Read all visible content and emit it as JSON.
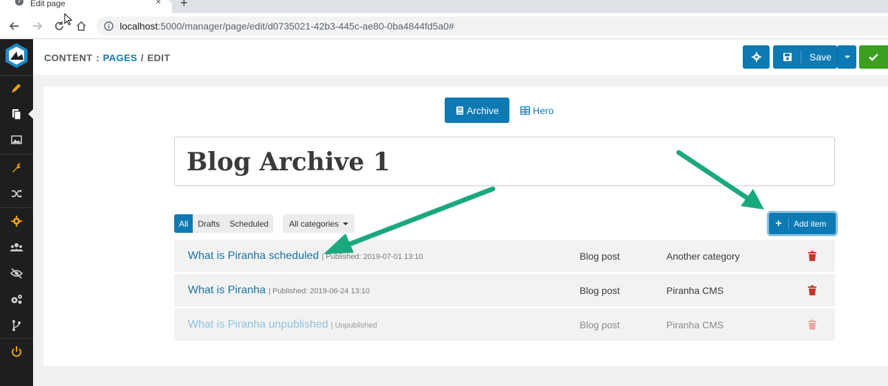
{
  "browser": {
    "tab_title": "Edit page",
    "new_tab": "+",
    "close": "×",
    "url_host": "localhost",
    "url_rest": ":5000/manager/page/edit/d0735021-42b3-445c-ae80-0ba4844fd5a0#"
  },
  "sidebar": {
    "items": [
      {
        "icon": "pencil-icon",
        "color": "#f0a30a"
      },
      {
        "icon": "pages-icon",
        "color": "#ffffff",
        "active": true
      },
      {
        "icon": "media-icon",
        "color": "#cfcfcf"
      },
      {
        "icon": "wrench-icon",
        "color": "#f0a30a"
      },
      {
        "icon": "shuffle-icon",
        "color": "#cfcfcf"
      },
      {
        "icon": "gear-icon",
        "color": "#f0a30a"
      },
      {
        "icon": "users-icon",
        "color": "#cfcfcf"
      },
      {
        "icon": "eye-slash-icon",
        "color": "#cfcfcf"
      },
      {
        "icon": "gears-icon",
        "color": "#cfcfcf"
      },
      {
        "icon": "branch-icon",
        "color": "#cfcfcf"
      },
      {
        "icon": "power-icon",
        "color": "#f0a30a"
      }
    ]
  },
  "header": {
    "breadcrumb_root": "CONTENT",
    "breadcrumb_sep1": ":",
    "breadcrumb_link": "PAGES",
    "breadcrumb_sep2": "/",
    "breadcrumb_current": "EDIT",
    "save_label": "Save"
  },
  "regions": {
    "tabs": [
      {
        "label": "Archive",
        "active": true
      },
      {
        "label": "Hero",
        "active": false
      }
    ]
  },
  "page": {
    "title": "Blog Archive 1"
  },
  "filters": {
    "status": [
      "All",
      "Drafts",
      "Scheduled"
    ],
    "category": "All categories",
    "add_item": "Add item"
  },
  "posts": [
    {
      "title": "What is Piranha scheduled",
      "meta": "| Published: 2019-07-01 13:10",
      "type": "Blog post",
      "category": "Another category",
      "published": true
    },
    {
      "title": "What is Piranha",
      "meta": "| Published: 2019-06-24 13:10",
      "type": "Blog post",
      "category": "Piranha CMS",
      "published": true
    },
    {
      "title": "What is Piranha unpublished",
      "meta": "| Unpublished",
      "type": "Blog post",
      "category": "Piranha CMS",
      "published": false
    }
  ],
  "colors": {
    "primary": "#0e7ab4",
    "success": "#3aa01e",
    "danger": "#c0392b",
    "arrow": "#1aa87f",
    "sidebar_bg": "#1e1e1e"
  }
}
